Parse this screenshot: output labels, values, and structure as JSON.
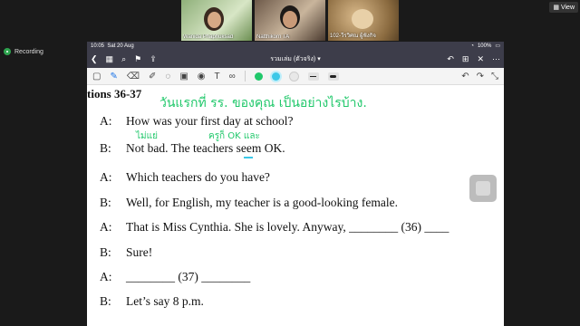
{
  "participants": [
    {
      "name": "Wanida Phaphuksad"
    },
    {
      "name": "Natthikorn TA"
    },
    {
      "name": "102-วีรวิศณ ผู้ฟังกิจ"
    }
  ],
  "top_right": {
    "view_label": "View"
  },
  "recording": {
    "label": "Recording"
  },
  "tablet": {
    "status": {
      "time": "10:05",
      "date": "Sat 20 Aug",
      "battery": "100%"
    },
    "nav": {
      "title": "รวมเล่ม (ตัวจริง)"
    },
    "toolbar": {
      "colors": [
        "#21c86b",
        "#3bc8e8",
        "#e8e8e8"
      ]
    }
  },
  "document": {
    "heading": "tions 36-37",
    "lines": [
      {
        "speaker": "A:",
        "text": "How was your first day at school?"
      },
      {
        "speaker": "B:",
        "text": "Not bad. The teachers seem OK."
      },
      {
        "speaker": "A:",
        "text": "Which teachers do you have?"
      },
      {
        "speaker": "B:",
        "text": "Well, for English, my teacher is a good-looking female."
      },
      {
        "speaker": "A:",
        "text": "That is Miss Cynthia. She is lovely. Anyway, ________ (36) ____"
      },
      {
        "speaker": "B:",
        "text": "Sure!"
      },
      {
        "speaker": "A:",
        "text": "________ (37) ________"
      },
      {
        "speaker": "B:",
        "text": "Let’s say 8 p.m."
      }
    ],
    "annotations": [
      {
        "text": "วันแรกที่ รร. ของคุณ เป็นอย่างไรบ้าง."
      },
      {
        "text": "ไม่แย่"
      },
      {
        "text": "ครูก็ OK และ"
      }
    ]
  }
}
